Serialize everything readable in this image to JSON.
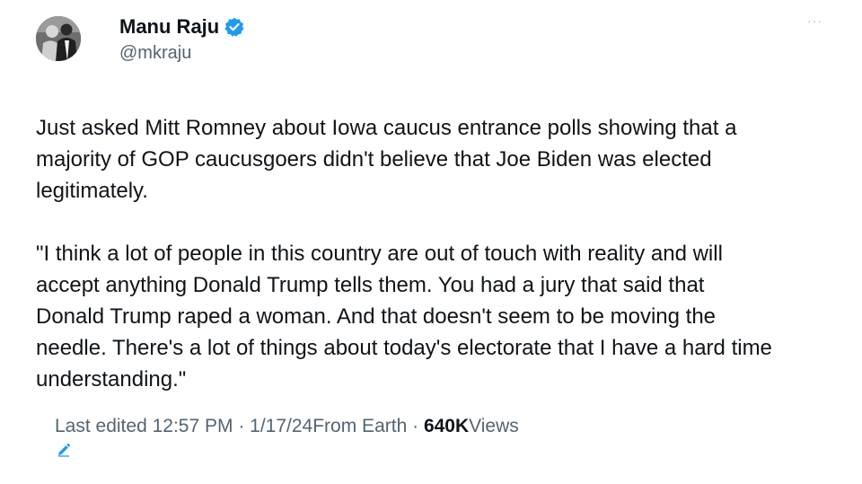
{
  "author": {
    "display_name": "Manu Raju",
    "handle": "@mkraju",
    "verified": true,
    "verified_color": "#1d9bf0",
    "avatar_icon": "profile-photo"
  },
  "more_menu": {
    "label": "···"
  },
  "tweet": {
    "paragraphs": [
      "Just asked Mitt Romney about Iowa caucus entrance polls showing that a\nmajority of GOP caucusgoers didn't believe that Joe Biden was elected\nlegitimately.",
      "\"I think a lot of people in this country are out of touch with reality and will\naccept anything Donald Trump tells them. You had a jury that said that\nDonald Trump raped a woman. And that doesn't seem to be moving the\nneedle. There's a lot of things about today's electorate that I have a hard time\nunderstanding.\""
    ]
  },
  "meta": {
    "edit_icon": "pencil-icon",
    "edited_label": "Last edited",
    "time": "12:57 PM",
    "separator1": " · ",
    "date": "1/17/24",
    "location": "From Earth",
    "separator2": " · ",
    "views_count": "640K",
    "views_label": "Views"
  }
}
